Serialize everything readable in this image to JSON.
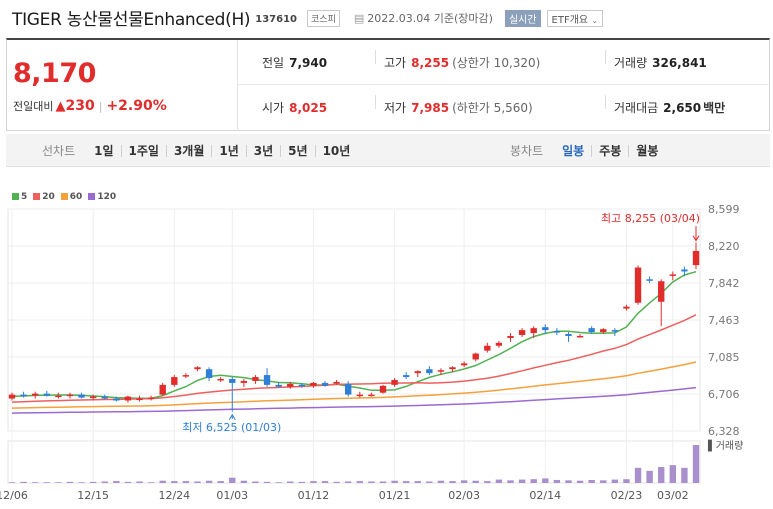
{
  "header": {
    "name": "TIGER 농산물선물Enhanced(H)",
    "code": "137610",
    "market": "코스피",
    "date": "2022.03.04",
    "basis": "기준(장마감)",
    "live": "실시간",
    "etf_info": "ETF개요"
  },
  "quote": {
    "price": "8,170",
    "change_label": "전일대비",
    "change_amount": "230",
    "change_pct": "+2.90%",
    "prev_close_label": "전일",
    "prev_close": "7,940",
    "high_label": "고가",
    "high": "8,255",
    "upper_limit": "(상한가 10,320)",
    "volume_label": "거래량",
    "volume": "326,841",
    "open_label": "시가",
    "open": "8,025",
    "low_label": "저가",
    "low": "7,985",
    "lower_limit": "(하한가 5,560)",
    "amount_label": "거래대금",
    "amount": "2,650",
    "amount_unit": "백만"
  },
  "periods": {
    "line_label": "선차트",
    "line_items": [
      "1일",
      "1주일",
      "3개월",
      "1년",
      "3년",
      "5년",
      "10년"
    ],
    "candle_label": "봉차트",
    "candle_items": [
      "일봉",
      "주봉",
      "월봉"
    ],
    "active": "일봉"
  },
  "legend": [
    {
      "label": "5",
      "color": "#52b152"
    },
    {
      "label": "20",
      "color": "#ee5f5f"
    },
    {
      "label": "60",
      "color": "#f5a13c"
    },
    {
      "label": "120",
      "color": "#9b6ad0"
    }
  ],
  "colors": {
    "up": "#e12c2c",
    "down": "#2f7fd6",
    "volume": "#a98fcc"
  },
  "chart_data": {
    "type": "candlestick",
    "y_ticks": [
      "8,599",
      "8,220",
      "7,842",
      "7,463",
      "7,085",
      "6,706",
      "6,328"
    ],
    "ylim": [
      6328,
      8599
    ],
    "x_ticks": [
      {
        "label": "12/06",
        "index": 0
      },
      {
        "label": "12/15",
        "index": 7
      },
      {
        "label": "12/24",
        "index": 14
      },
      {
        "label": "01/03",
        "index": 19
      },
      {
        "label": "01/12",
        "index": 26
      },
      {
        "label": "01/21",
        "index": 33
      },
      {
        "label": "02/03",
        "index": 39
      },
      {
        "label": "02/14",
        "index": 46
      },
      {
        "label": "02/23",
        "index": 53
      },
      {
        "label": "03/02",
        "index": 57
      }
    ],
    "max_annotation": {
      "text": "최고 8,255 (03/04)",
      "index": 59,
      "value": 8255
    },
    "min_annotation": {
      "text": "최저 6,525 (01/03)",
      "index": 19,
      "value": 6525
    },
    "volume_label": "거래량",
    "candles": [
      [
        6660,
        6720,
        6640,
        6700
      ],
      [
        6700,
        6730,
        6670,
        6690
      ],
      [
        6690,
        6730,
        6660,
        6710
      ],
      [
        6710,
        6740,
        6680,
        6690
      ],
      [
        6690,
        6720,
        6660,
        6690
      ],
      [
        6690,
        6720,
        6660,
        6700
      ],
      [
        6700,
        6720,
        6660,
        6670
      ],
      [
        6670,
        6700,
        6640,
        6680
      ],
      [
        6680,
        6700,
        6650,
        6660
      ],
      [
        6660,
        6680,
        6630,
        6640
      ],
      [
        6640,
        6690,
        6620,
        6680
      ],
      [
        6660,
        6690,
        6630,
        6660
      ],
      [
        6660,
        6690,
        6640,
        6670
      ],
      [
        6700,
        6820,
        6690,
        6800
      ],
      [
        6800,
        6900,
        6780,
        6880
      ],
      [
        6900,
        6920,
        6870,
        6900
      ],
      [
        6960,
        6990,
        6940,
        6980
      ],
      [
        6960,
        6980,
        6840,
        6870
      ],
      [
        6860,
        6880,
        6830,
        6860
      ],
      [
        6860,
        6880,
        6525,
        6820
      ],
      [
        6820,
        6860,
        6780,
        6840
      ],
      [
        6840,
        6900,
        6810,
        6880
      ],
      [
        6900,
        6970,
        6780,
        6800
      ],
      [
        6800,
        6830,
        6770,
        6780
      ],
      [
        6780,
        6830,
        6760,
        6810
      ],
      [
        6800,
        6820,
        6770,
        6790
      ],
      [
        6790,
        6830,
        6770,
        6820
      ],
      [
        6820,
        6840,
        6780,
        6790
      ],
      [
        6820,
        6850,
        6800,
        6830
      ],
      [
        6810,
        6840,
        6680,
        6700
      ],
      [
        6700,
        6730,
        6670,
        6700
      ],
      [
        6700,
        6720,
        6680,
        6700
      ],
      [
        6720,
        6800,
        6710,
        6790
      ],
      [
        6800,
        6870,
        6780,
        6850
      ],
      [
        6900,
        6930,
        6860,
        6880
      ],
      [
        6920,
        6950,
        6880,
        6940
      ],
      [
        6960,
        6990,
        6900,
        6920
      ],
      [
        6940,
        6970,
        6900,
        6950
      ],
      [
        6960,
        6990,
        6930,
        6980
      ],
      [
        7000,
        7040,
        6980,
        7020
      ],
      [
        7060,
        7130,
        7040,
        7120
      ],
      [
        7150,
        7230,
        7130,
        7200
      ],
      [
        7200,
        7250,
        7180,
        7230
      ],
      [
        7280,
        7330,
        7240,
        7300
      ],
      [
        7310,
        7380,
        7290,
        7360
      ],
      [
        7330,
        7400,
        7280,
        7380
      ],
      [
        7390,
        7420,
        7320,
        7360
      ],
      [
        7350,
        7380,
        7310,
        7340
      ],
      [
        7320,
        7340,
        7240,
        7300
      ],
      [
        7300,
        7320,
        7290,
        7300
      ],
      [
        7380,
        7400,
        7320,
        7340
      ],
      [
        7340,
        7380,
        7320,
        7370
      ],
      [
        7360,
        7380,
        7300,
        7350
      ],
      [
        7580,
        7620,
        7560,
        7600
      ],
      [
        7640,
        8020,
        7620,
        8000
      ],
      [
        7880,
        7910,
        7840,
        7870
      ],
      [
        7650,
        7880,
        7400,
        7860
      ],
      [
        7920,
        7960,
        7870,
        7930
      ],
      [
        7980,
        8010,
        7910,
        7960
      ],
      [
        8025,
        8255,
        7985,
        8170
      ]
    ],
    "volumes": [
      0.02,
      0.03,
      0.02,
      0.02,
      0.02,
      0.03,
      0.02,
      0.03,
      0.04,
      0.05,
      0.03,
      0.04,
      0.02,
      0.06,
      0.05,
      0.05,
      0.04,
      0.06,
      0.05,
      0.14,
      0.06,
      0.04,
      0.03,
      0.02,
      0.04,
      0.03,
      0.05,
      0.05,
      0.03,
      0.04,
      0.05,
      0.04,
      0.04,
      0.06,
      0.05,
      0.05,
      0.04,
      0.06,
      0.05,
      0.07,
      0.06,
      0.05,
      0.09,
      0.07,
      0.09,
      0.1,
      0.12,
      0.08,
      0.07,
      0.06,
      0.08,
      0.07,
      0.09,
      0.1,
      0.4,
      0.32,
      0.42,
      0.47,
      0.4,
      1.0
    ]
  }
}
